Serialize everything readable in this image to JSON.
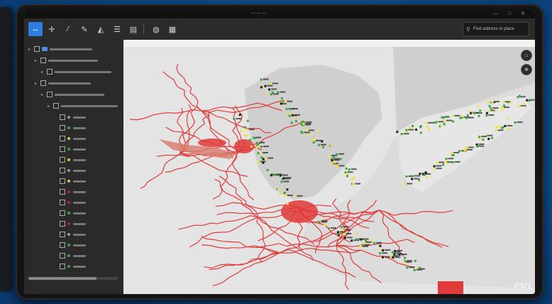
{
  "window": {
    "title": "— — —",
    "controls": "— □ ✕"
  },
  "toolbar": {
    "tools": [
      {
        "icon": "navigate-icon",
        "glyph": "↔",
        "active": true
      },
      {
        "icon": "pan-icon",
        "glyph": "✛"
      },
      {
        "icon": "draw-line-icon",
        "glyph": "∕"
      },
      {
        "icon": "pencil-icon",
        "glyph": "✎"
      },
      {
        "icon": "measure-icon",
        "glyph": "◭"
      },
      {
        "icon": "layers-icon",
        "glyph": "☰"
      },
      {
        "icon": "document-icon",
        "glyph": "▤"
      },
      {
        "icon": "globe-icon",
        "glyph": "◍"
      },
      {
        "icon": "table-icon",
        "glyph": "▦"
      }
    ]
  },
  "search": {
    "icon": "search-icon",
    "placeholder": "Find address or place"
  },
  "map_controls": {
    "home": "⌂",
    "compass": "⊕"
  },
  "legend": {
    "rows": [
      {
        "indent": 0,
        "label": "",
        "type": "folder"
      },
      {
        "indent": 1,
        "label": "",
        "type": "group"
      },
      {
        "indent": 2,
        "label": "",
        "type": "sub"
      },
      {
        "indent": 1,
        "label": "",
        "type": "group"
      },
      {
        "indent": 2,
        "label": "",
        "type": "group"
      },
      {
        "indent": 3,
        "label": "",
        "type": "group"
      },
      {
        "indent": 4,
        "label": "",
        "color": "#9b9b9b"
      },
      {
        "indent": 4,
        "label": "",
        "color": "#3aa53a"
      },
      {
        "indent": 4,
        "label": "",
        "color": "#e0c23a"
      },
      {
        "indent": 4,
        "label": "",
        "color": "#3aa53a"
      },
      {
        "indent": 4,
        "label": "",
        "color": "#e0c23a"
      },
      {
        "indent": 4,
        "label": "",
        "color": "#9b9b9b"
      },
      {
        "indent": 4,
        "label": "",
        "color": "#e0c23a"
      },
      {
        "indent": 4,
        "label": "",
        "color": "#b3261e"
      },
      {
        "indent": 4,
        "label": "",
        "color": "#b3261e"
      },
      {
        "indent": 4,
        "label": "",
        "color": "#3aa53a"
      },
      {
        "indent": 4,
        "label": "",
        "color": "#b3261e"
      },
      {
        "indent": 4,
        "label": "",
        "color": "#9b9b9b"
      },
      {
        "indent": 4,
        "label": "",
        "color": "#3aa53a"
      },
      {
        "indent": 4,
        "label": "",
        "color": "#3aa53a"
      },
      {
        "indent": 4,
        "label": "",
        "color": "#3aa53a"
      }
    ]
  },
  "statusbar": {
    "coordinates": ""
  },
  "brand": {
    "logo": "esri"
  },
  "colors": {
    "accent": "#2f7de1",
    "network": "#e03a3a",
    "good": "#3aa53a",
    "warn": "#f2e23a"
  }
}
